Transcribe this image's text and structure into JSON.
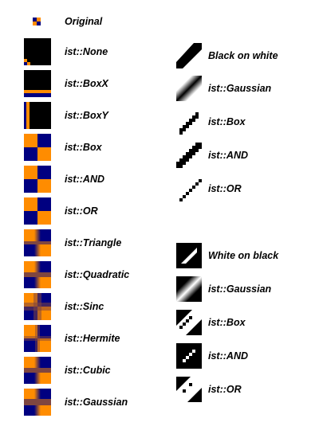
{
  "colors": {
    "orange": "#ff8c00",
    "navy": "#000080",
    "black": "#000000",
    "white": "#ffffff"
  },
  "original": {
    "label": "Original"
  },
  "filters": [
    {
      "label": "ist::None"
    },
    {
      "label": "ist::BoxX"
    },
    {
      "label": "ist::BoxY"
    },
    {
      "label": "ist::Box"
    },
    {
      "label": "ist::AND"
    },
    {
      "label": "ist::OR"
    },
    {
      "label": "ist::Triangle"
    },
    {
      "label": "ist::Quadratic"
    },
    {
      "label": "ist::Sinc"
    },
    {
      "label": "ist::Hermite"
    },
    {
      "label": "ist::Cubic"
    },
    {
      "label": "ist::Gaussian"
    }
  ],
  "black_on_white": {
    "title": "Black on white",
    "items": [
      {
        "label": "ist::Gaussian"
      },
      {
        "label": "ist::Box"
      },
      {
        "label": "ist::AND"
      },
      {
        "label": "ist::OR"
      }
    ]
  },
  "white_on_black": {
    "title": "White on black",
    "items": [
      {
        "label": "ist::Gaussian"
      },
      {
        "label": "ist::Box"
      },
      {
        "label": "ist::AND"
      },
      {
        "label": "ist::OR"
      }
    ]
  }
}
